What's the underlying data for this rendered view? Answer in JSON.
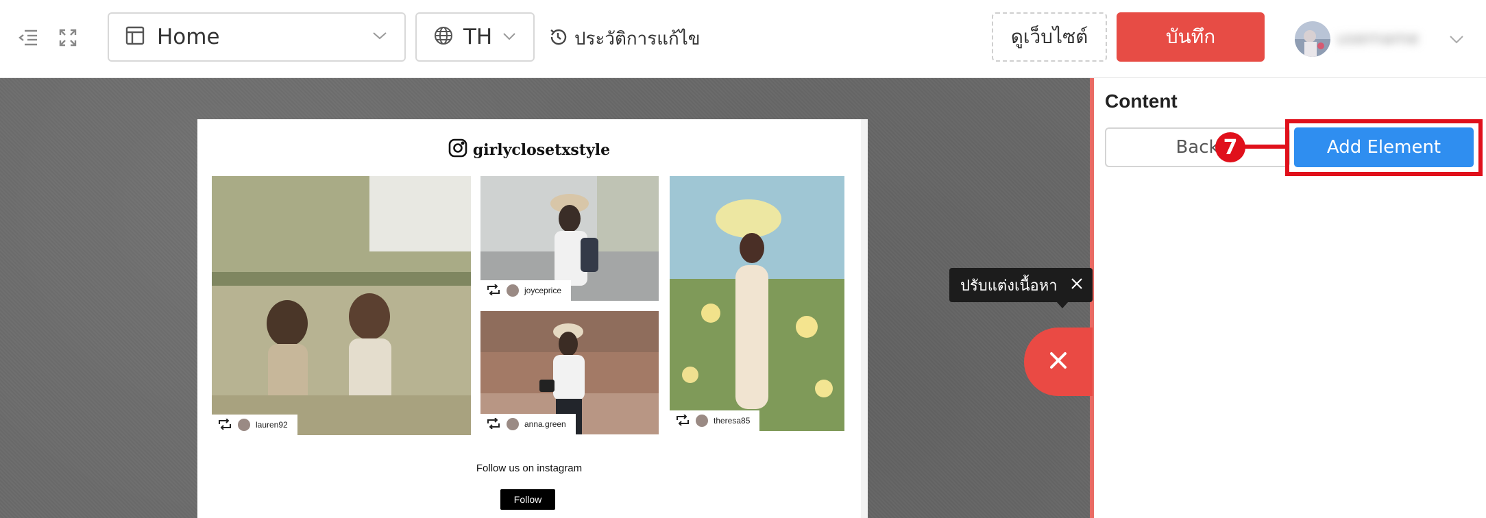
{
  "toolbar": {
    "page_select_value": "Home",
    "language_value": "TH",
    "history_label": "ประวัติการแก้ไข",
    "view_site_label": "ดูเว็บไซต์",
    "save_label": "บันทึก",
    "username": "username"
  },
  "canvas": {
    "instagram_handle": "girlyclosetxstyle",
    "photos": [
      {
        "username": "lauren92"
      },
      {
        "username": "joyceprice"
      },
      {
        "username": "anna.green"
      },
      {
        "username": "theresa85"
      }
    ],
    "follow_text": "Follow us on instagram",
    "follow_button": "Follow",
    "tooltip_text": "ปรับแต่งเนื้อหา"
  },
  "panel": {
    "title": "Content",
    "back_label": "Back",
    "add_element_label": "Add Element"
  },
  "annotation": {
    "step_number": "7"
  },
  "colors": {
    "accent_red": "#e74c45",
    "primary_blue": "#2f8ef0",
    "highlight_red": "#e0101b"
  }
}
